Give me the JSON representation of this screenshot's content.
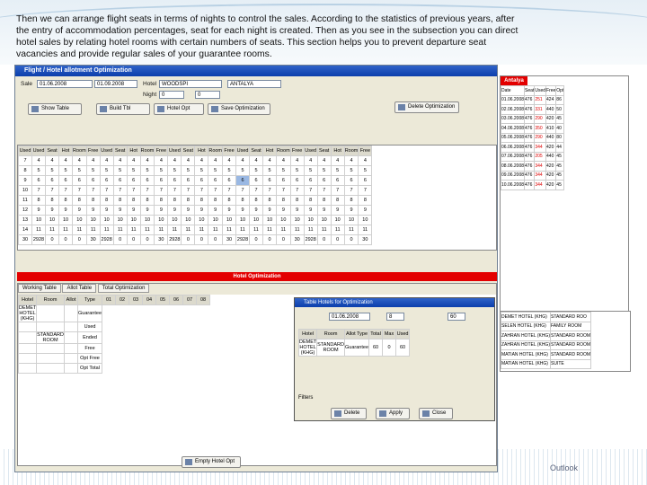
{
  "intro": "Then we can arrange flight seats  in terms of nights to control the sales. According to the statistics of previous years, after the entry of accommodation percentages, seat for each night is created. Then as you see in the subsection you can direct hotel sales by relating hotel rooms with certain numbers of seats. This section helps you to prevent  departure seat vacancies and provide regular sales of your guarantee rooms.",
  "window": {
    "title": "Flight / Hotel allotment Optimization"
  },
  "criteria": {
    "date_from": "01.06.2008",
    "date_to": "01.09.2008",
    "hotel": "WOODSPI",
    "dep": "ANTALYA",
    "night_from": "0",
    "night_to": "0",
    "label_date": "Sale",
    "label_hotel": "Hotel",
    "label_night": "Night"
  },
  "toolbar": {
    "b1": "Show Table",
    "b2": "Build Tbl",
    "b3": "Hotel Opt",
    "b4": "Save Optimization",
    "b5": "Delete Optimization"
  },
  "grid": {
    "groups": [
      "1",
      "2",
      "3",
      "4",
      "5"
    ],
    "headers": [
      "Used",
      "Seat",
      "Hot",
      "Room",
      "Free"
    ],
    "rows": [
      [
        "7",
        "4"
      ],
      [
        "8",
        "5"
      ],
      [
        "9",
        "6"
      ],
      [
        "10",
        "7"
      ],
      [
        "11",
        "8"
      ],
      [
        "12",
        "9"
      ],
      [
        "13",
        "10"
      ],
      [
        "14",
        "11"
      ]
    ],
    "totals": [
      "30",
      "2928",
      "0",
      "0",
      "0"
    ]
  },
  "red_bar": "Hotel Optimization",
  "tabs": [
    "Working Table",
    "Allot Table",
    "Total Optimization"
  ],
  "lower": {
    "headers": [
      "Hotel",
      "Room",
      "Allot",
      "Type",
      "01",
      "02",
      "03",
      "04",
      "05",
      "06",
      "07",
      "08"
    ],
    "hotel": "DEMET HOTEL (KHG)",
    "room": "STANDARD ROOM",
    "types": [
      "Guarantee",
      "Used",
      "Ended",
      "Free",
      "Opt Free",
      "Opt Total"
    ]
  },
  "dialog": {
    "title": "Table Hotels for Optimization",
    "flight_date": "01.06.2008",
    "days": "8",
    "max_seats": "60",
    "headers": [
      "Hotel",
      "Room",
      "Allot Type",
      "Total",
      "Max",
      "Used"
    ],
    "row": [
      "DEMET HOTEL (KHG)",
      "STANDARD ROOM",
      "Guarantee",
      "60",
      "0",
      "60"
    ],
    "filter": "Filters",
    "delete": "Delete",
    "apply": "Apply",
    "close": "Close"
  },
  "empty_btn": "Empty Hotel Opt",
  "right": {
    "title": "Antalya",
    "headers": [
      "Date",
      "Seat",
      "Used",
      "Free",
      "Opt"
    ],
    "rows": [
      [
        "01.06.2008",
        "476",
        "251",
        "424",
        "86"
      ],
      [
        "02.06.2008",
        "476",
        "331",
        "440",
        "50"
      ],
      [
        "03.06.2008",
        "476",
        "290",
        "420",
        "45"
      ],
      [
        "04.06.2008",
        "476",
        "350",
        "410",
        "40"
      ],
      [
        "05.06.2008",
        "476",
        "290",
        "440",
        "80"
      ],
      [
        "06.06.2008",
        "476",
        "344",
        "420",
        "44"
      ],
      [
        "07.06.2008",
        "476",
        "205",
        "440",
        "45"
      ],
      [
        "08.06.2008",
        "476",
        "344",
        "420",
        "45"
      ],
      [
        "09.06.2008",
        "476",
        "344",
        "420",
        "45"
      ],
      [
        "10.06.2008",
        "476",
        "344",
        "420",
        "45"
      ]
    ]
  },
  "hotels": [
    [
      "DEMET HOTEL (KHG)",
      "STANDARD ROO"
    ],
    [
      "SELEN HOTEL (KHG)",
      "FAMILY ROOM"
    ],
    [
      "ZAHRAN HOTEL (KHG)",
      "STANDARD ROOM"
    ],
    [
      "ZAHRAN HOTEL (KHG)",
      "STANDARD ROOM"
    ],
    [
      "MATIAN HOTEL (KHG)",
      "STANDARD ROOM"
    ],
    [
      "MATIAN HOTEL (KHG)",
      "SUITE"
    ]
  ],
  "footer": "Outlook"
}
